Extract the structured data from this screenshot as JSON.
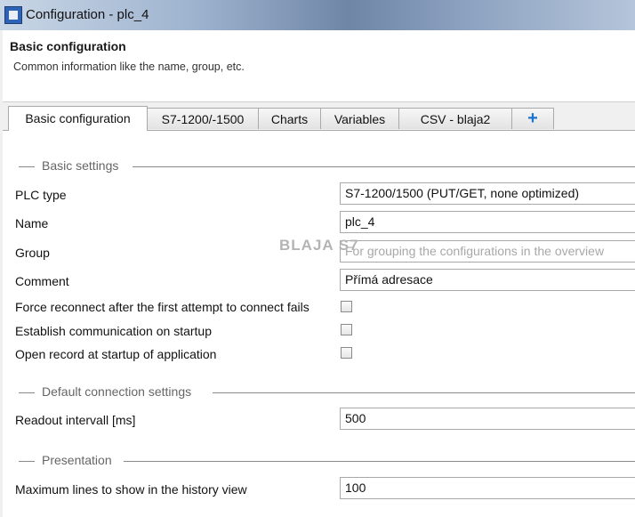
{
  "window": {
    "title": "Configuration - plc_4"
  },
  "header": {
    "title": "Basic configuration",
    "subtitle": "Common information like the name, group, etc."
  },
  "tabs": [
    {
      "label": "Basic configuration"
    },
    {
      "label": "S7-1200/-1500"
    },
    {
      "label": "Charts"
    },
    {
      "label": "Variables"
    },
    {
      "label": "CSV - blaja2"
    },
    {
      "label": "+"
    }
  ],
  "sections": {
    "basic": "Basic settings",
    "connection": "Default connection settings",
    "presentation": "Presentation"
  },
  "fields": {
    "plc_type": {
      "label": "PLC type",
      "value": "S7-1200/1500 (PUT/GET, none optimized)"
    },
    "name": {
      "label": "Name",
      "value": "plc_4"
    },
    "group": {
      "label": "Group",
      "placeholder": "For grouping the configurations in the overview"
    },
    "comment": {
      "label": "Comment",
      "value": "Přímá adresace"
    },
    "force_reconnect": {
      "label": "Force reconnect after the first attempt to connect fails",
      "checked": false
    },
    "comm_startup": {
      "label": "Establish communication on startup",
      "checked": false
    },
    "open_record": {
      "label": "Open record at startup of application",
      "checked": false
    },
    "readout": {
      "label": "Readout intervall [ms]",
      "value": "500"
    },
    "max_lines": {
      "label": "Maximum lines to show in the history view",
      "value": "100"
    }
  },
  "watermark": "BLAJA S7",
  "icons": {
    "app": "app-window-icon",
    "add_tab": "plus-icon"
  }
}
